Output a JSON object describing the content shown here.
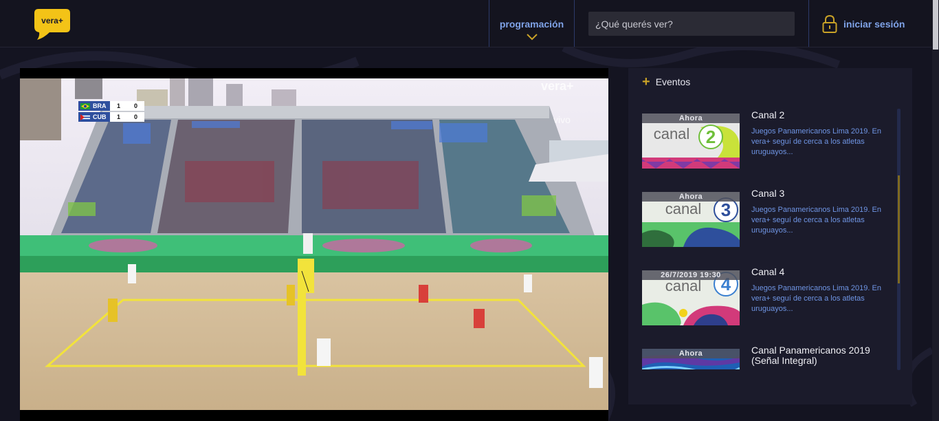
{
  "brand": {
    "name": "vera+",
    "accent": "#f3c317"
  },
  "header": {
    "nav_programacion": "programación",
    "search_placeholder": "¿Qué querés ver?",
    "login_label": "iniciar sesión"
  },
  "player": {
    "scoreboard": [
      {
        "team": "BRA",
        "set1": "1",
        "set2": "0"
      },
      {
        "team": "CUB",
        "set1": "1",
        "set2": "0"
      }
    ],
    "watermark_brand": "vera+",
    "watermark_live": "vivo"
  },
  "events": {
    "title": "Eventos",
    "items": [
      {
        "badge": "Ahora",
        "channel": "Canal 2",
        "description": "Juegos Panamericanos Lima 2019. En vera+ seguí de cerca a los atletas uruguayos...",
        "logo_text": "canal",
        "logo_number": "2",
        "number_color": "#6fbf3a"
      },
      {
        "badge": "Ahora",
        "channel": "Canal 3",
        "description": "Juegos Panamericanos Lima 2019. En vera+ seguí de cerca a los atletas uruguayos...",
        "logo_text": "canal",
        "logo_number": "3",
        "number_color": "#2e4f9c"
      },
      {
        "badge": "26/7/2019 19:30",
        "channel": "Canal 4",
        "description": "Juegos Panamericanos Lima 2019. En vera+ seguí de cerca a los atletas uruguayos...",
        "logo_text": "canal",
        "logo_number": "4",
        "number_color": "#3a7fd0"
      },
      {
        "badge": "Ahora",
        "channel": "Canal Panamericanos 2019 (Señal Integral)",
        "description": "",
        "logo_text": "",
        "logo_number": "",
        "number_color": "#1f5fb4"
      }
    ]
  }
}
